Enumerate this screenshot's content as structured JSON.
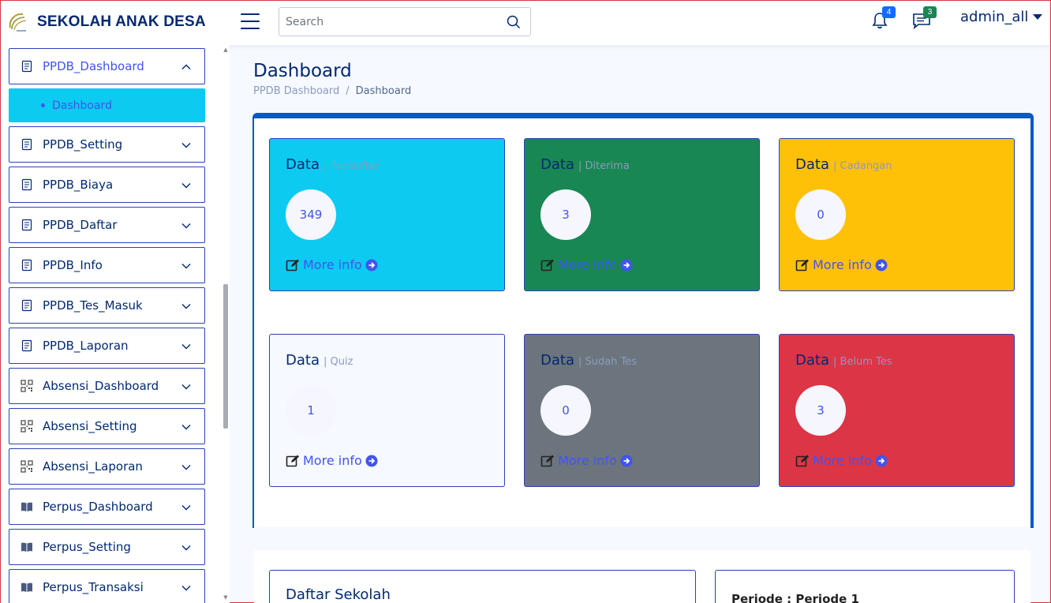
{
  "header": {
    "brand": "SEKOLAH ANAK DESA",
    "search_placeholder": "Search",
    "notifications_count": "4",
    "messages_count": "3",
    "user": "admin_all",
    "colors": {
      "brand": "#012970",
      "notif_badge": "#0d6efd",
      "msg_badge": "#198754"
    }
  },
  "sidebar": {
    "items": [
      {
        "label": "PPDB_Dashboard",
        "icon": "document-icon",
        "expanded": true
      },
      {
        "label": "PPDB_Setting",
        "icon": "document-icon"
      },
      {
        "label": "PPDB_Biaya",
        "icon": "document-icon"
      },
      {
        "label": "PPDB_Daftar",
        "icon": "document-icon"
      },
      {
        "label": "PPDB_Info",
        "icon": "document-icon"
      },
      {
        "label": "PPDB_Tes_Masuk",
        "icon": "document-icon"
      },
      {
        "label": "PPDB_Laporan",
        "icon": "document-icon"
      },
      {
        "label": "Absensi_Dashboard",
        "icon": "qr-code-icon"
      },
      {
        "label": "Absensi_Setting",
        "icon": "qr-code-icon"
      },
      {
        "label": "Absensi_Laporan",
        "icon": "qr-code-icon"
      },
      {
        "label": "Perpus_Dashboard",
        "icon": "book-icon"
      },
      {
        "label": "Perpus_Setting",
        "icon": "book-icon"
      },
      {
        "label": "Perpus_Transaksi",
        "icon": "book-icon"
      }
    ],
    "submenu": {
      "label": "Dashboard"
    }
  },
  "main": {
    "title": "Dashboard",
    "breadcrumb": {
      "parent": "PPDB Dashboard",
      "separator": "/",
      "current": "Dashboard"
    },
    "cards": [
      {
        "title": "Data",
        "subtitle": "| Pendaftar",
        "count": "349",
        "more": "More info",
        "bg": "#0dcaf0"
      },
      {
        "title": "Data",
        "subtitle": "| Diterima",
        "count": "3",
        "more": "More info",
        "bg": "#198754"
      },
      {
        "title": "Data",
        "subtitle": "| Cadangan",
        "count": "0",
        "more": "More info",
        "bg": "#ffc107"
      },
      {
        "title": "Data",
        "subtitle": "| Quiz",
        "count": "1",
        "more": "More info",
        "bg": "#f6f9ff"
      },
      {
        "title": "Data",
        "subtitle": "| Sudah Tes",
        "count": "0",
        "more": "More info",
        "bg": "#6c757d"
      },
      {
        "title": "Data",
        "subtitle": "| Belum Tes",
        "count": "3",
        "more": "More info",
        "bg": "#dc3545"
      }
    ],
    "bottom": {
      "left_title": "Daftar Sekolah",
      "right_title": "Periode : Periode 1"
    }
  }
}
